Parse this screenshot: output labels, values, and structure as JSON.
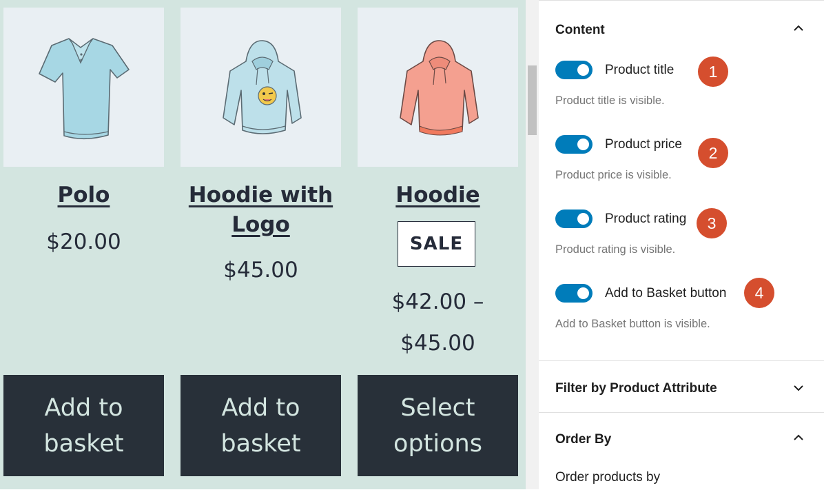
{
  "preview": {
    "products": [
      {
        "title": "Polo",
        "price": "$20.00",
        "button": "Add to basket"
      },
      {
        "title": "Hoodie with Logo",
        "price": "$45.00",
        "button": "Add to basket"
      },
      {
        "title": "Hoodie",
        "badge": "SALE",
        "price_from": "$42.00 –",
        "price_to": "$45.00",
        "button": "Select options"
      }
    ]
  },
  "panel": {
    "content_section": {
      "title": "Content",
      "expanded": true,
      "toggles": [
        {
          "label": "Product title",
          "help": "Product title is visible.",
          "on": true,
          "marker": "1"
        },
        {
          "label": "Product price",
          "help": "Product price is visible.",
          "on": true,
          "marker": "2"
        },
        {
          "label": "Product rating",
          "help": "Product rating is visible.",
          "on": true,
          "marker": "3"
        },
        {
          "label": "Add to Basket button",
          "help": "Add to Basket button is visible.",
          "on": true,
          "marker": "4"
        }
      ]
    },
    "filter_section": {
      "title": "Filter by Product Attribute",
      "expanded": false
    },
    "order_section": {
      "title": "Order By",
      "expanded": true,
      "label": "Order products by"
    }
  },
  "colors": {
    "preview_bg": "#d3e5e0",
    "button_bg": "#283039",
    "toggle_on": "#007cba",
    "marker": "#d54e2e"
  },
  "icons": {
    "collapse": "chevron-up-icon",
    "expand": "chevron-down-icon"
  }
}
